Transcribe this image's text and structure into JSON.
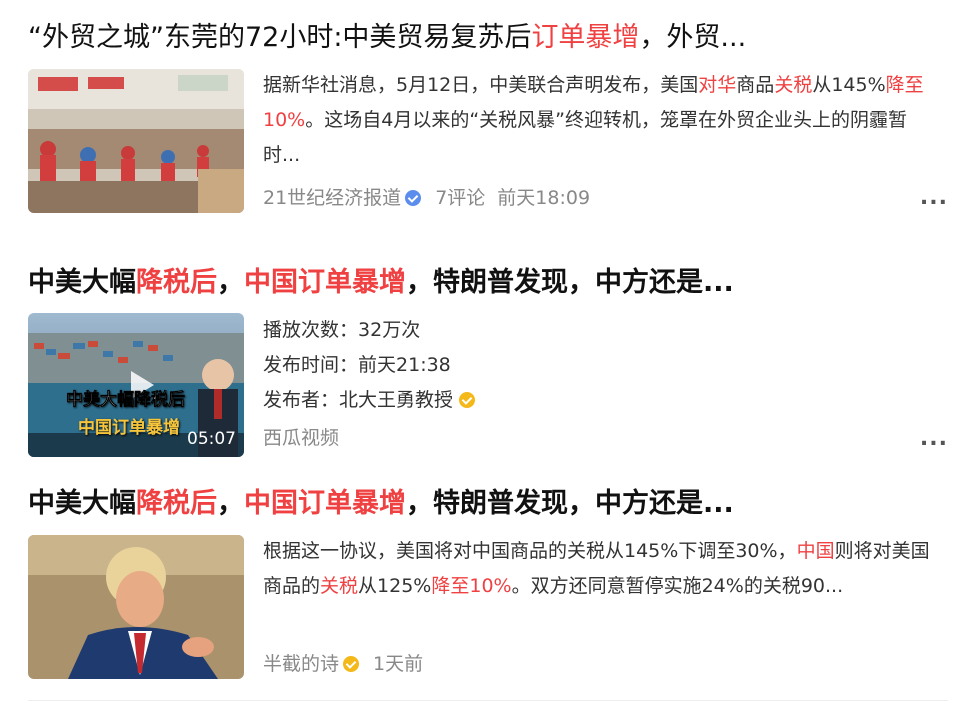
{
  "results": [
    {
      "title_parts": [
        {
          "text": "“外贸之城”东莞的72小时:中美贸易复苏后",
          "hl": false
        },
        {
          "text": "订单暴增",
          "hl": true
        },
        {
          "text": "，外贸...",
          "hl": false
        }
      ],
      "snippet_parts": [
        {
          "text": "据新华社消息，5月12日，中美联合声明发布，美国",
          "hl": false
        },
        {
          "text": "对华",
          "hl": true
        },
        {
          "text": "商品",
          "hl": false
        },
        {
          "text": "关税",
          "hl": true
        },
        {
          "text": "从145%",
          "hl": false
        },
        {
          "text": "降至10%",
          "hl": true
        },
        {
          "text": "。这场自4月以来的“关税风暴”终迎转机，笼罩在外贸企业头上的阴霾暂时...",
          "hl": false
        }
      ],
      "source": "21世纪经济报道",
      "comments": "7评论",
      "time": "前天18:09"
    },
    {
      "title_parts": [
        {
          "text": "中美大幅",
          "hl": false
        },
        {
          "text": "降税后",
          "hl": true
        },
        {
          "text": "，",
          "hl": false
        },
        {
          "text": "中国订单暴增",
          "hl": true
        },
        {
          "text": "，特朗普发现，中方还是...",
          "hl": false
        }
      ],
      "plays_label": "播放次数：",
      "plays": "32万次",
      "publish_label": "发布时间：",
      "publish_time": "前天21:38",
      "publisher_label": "发布者：",
      "publisher": "北大王勇教授",
      "source": "西瓜视频",
      "overlay_line1": "中美大幅降税后",
      "overlay_line2": "中国订单暴增",
      "duration": "05:07"
    },
    {
      "title_parts": [
        {
          "text": "中美大幅",
          "hl": false
        },
        {
          "text": "降税后",
          "hl": true
        },
        {
          "text": "，",
          "hl": false
        },
        {
          "text": "中国订单暴增",
          "hl": true
        },
        {
          "text": "，特朗普发现，中方还是...",
          "hl": false
        }
      ],
      "snippet_parts": [
        {
          "text": "根据这一协议，美国将对中国商品的关税从145%下调至30%，",
          "hl": false
        },
        {
          "text": "中国",
          "hl": true
        },
        {
          "text": "则将对美国商品的",
          "hl": false
        },
        {
          "text": "关税",
          "hl": true
        },
        {
          "text": "从125%",
          "hl": false
        },
        {
          "text": "降至10%",
          "hl": true
        },
        {
          "text": "。双方还同意暂停实施24%的关税90...",
          "hl": false
        }
      ],
      "source": "半截的诗",
      "time": "1天前"
    }
  ],
  "more_label": "..."
}
